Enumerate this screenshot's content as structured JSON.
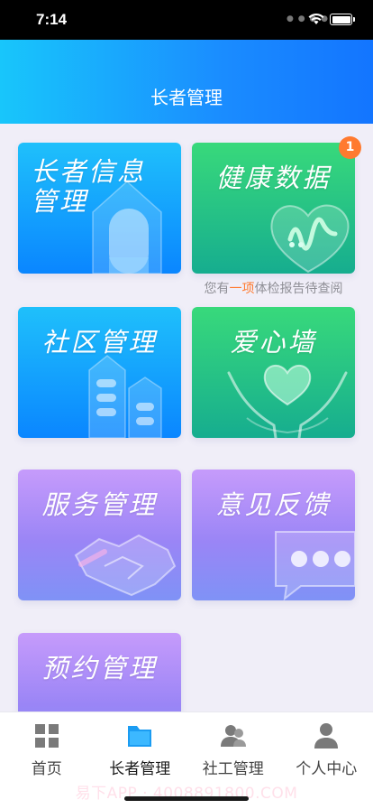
{
  "status_bar": {
    "time": "7:14"
  },
  "header": {
    "title": "长者管理"
  },
  "cards": {
    "elder_info": {
      "title": "长者信息管理"
    },
    "health_data": {
      "title": "健康数据",
      "badge": "1"
    },
    "community": {
      "title": "社区管理"
    },
    "love_wall": {
      "title": "爱心墙"
    },
    "service": {
      "title": "服务管理"
    },
    "feedback": {
      "title": "意见反馈"
    },
    "appointment": {
      "title": "预约管理"
    }
  },
  "health_note": {
    "prefix": "您有",
    "highlight": "一项",
    "suffix": "体检报告待查阅"
  },
  "tabbar": {
    "items": [
      {
        "label": "首页",
        "icon": "grid-icon"
      },
      {
        "label": "长者管理",
        "icon": "folder-icon"
      },
      {
        "label": "社工管理",
        "icon": "group-icon"
      },
      {
        "label": "个人中心",
        "icon": "person-icon"
      }
    ],
    "active_index": 1
  },
  "watermark": "易下APP · 4008891800.COM",
  "colors": {
    "accent_blue": "#1a8cff",
    "accent_green": "#2cc47f",
    "accent_purple": "#a88cf7",
    "badge_orange": "#ff7a2f"
  }
}
